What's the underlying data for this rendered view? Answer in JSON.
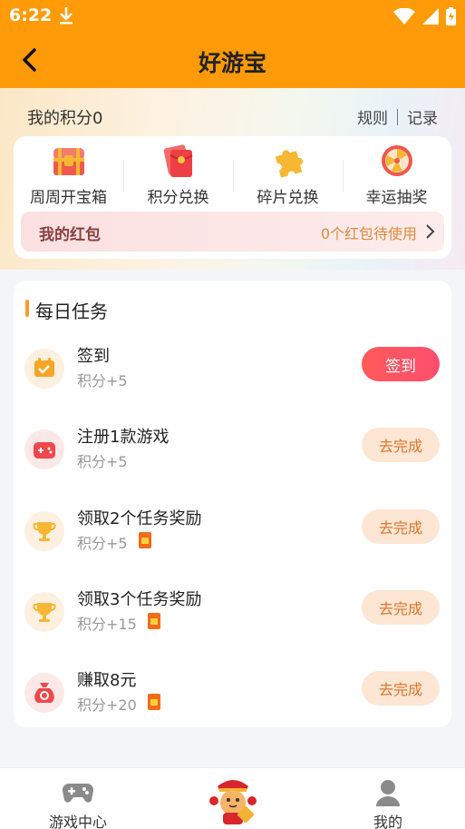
{
  "status_bar": {
    "time": "6:22"
  },
  "header": {
    "title": "好游宝"
  },
  "points": {
    "label": "我的积分0",
    "rules": "规则",
    "records": "记录"
  },
  "menu": [
    {
      "label": "周周开宝箱",
      "icon": "treasure-chest-icon"
    },
    {
      "label": "积分兑换",
      "icon": "red-envelope-icon"
    },
    {
      "label": "碎片兑换",
      "icon": "puzzle-piece-icon"
    },
    {
      "label": "幸运抽奖",
      "icon": "lucky-wheel-icon"
    }
  ],
  "red_packet": {
    "title": "我的红包",
    "status": "0个红包待使用"
  },
  "daily_tasks": {
    "title": "每日任务",
    "items": [
      {
        "title": "签到",
        "reward": "积分+5",
        "button": "签到",
        "icon": "calendar-check-icon",
        "has_packet": false
      },
      {
        "title": "注册1款游戏",
        "reward": "积分+5",
        "button": "去完成",
        "icon": "game-controller-icon",
        "has_packet": false
      },
      {
        "title": "领取2个任务奖励",
        "reward": "积分+5",
        "button": "去完成",
        "icon": "trophy-icon",
        "has_packet": true
      },
      {
        "title": "领取3个任务奖励",
        "reward": "积分+15",
        "button": "去完成",
        "icon": "trophy-icon",
        "has_packet": true
      },
      {
        "title": "赚取8元",
        "reward": "积分+20",
        "button": "去完成",
        "icon": "money-bag-icon",
        "has_packet": true
      }
    ]
  },
  "tabbar": {
    "tabs": [
      {
        "label": "游戏中心",
        "icon": "gamepad-icon"
      },
      {
        "label": "",
        "icon": "mascot-icon"
      },
      {
        "label": "我的",
        "icon": "user-icon"
      }
    ]
  },
  "colors": {
    "brand": "#ff9a08",
    "primary_button": "#fd4e6e",
    "secondary_button_bg": "#fde6d3",
    "secondary_button_text": "#e0742a"
  }
}
